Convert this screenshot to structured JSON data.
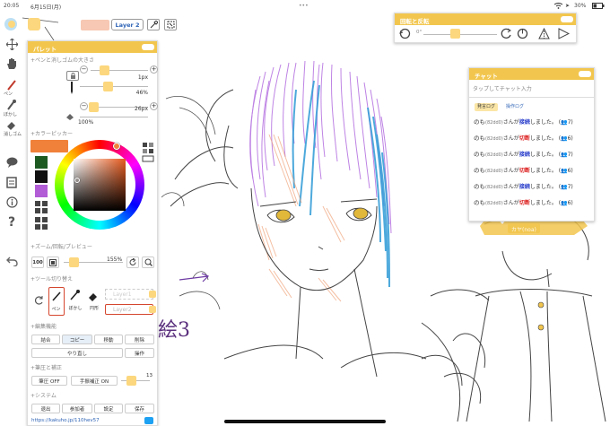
{
  "status": {
    "time": "20:05",
    "date": "6月15日(月)",
    "battery": "30%",
    "menu_dots": "•••"
  },
  "topbar": {
    "layer_label": "Layer 2"
  },
  "tools": [
    {
      "name": "pen",
      "label": "ペン"
    },
    {
      "name": "blur",
      "label": "ぼかし"
    },
    {
      "name": "eraser",
      "label": "消しゴム"
    },
    {
      "name": "fill",
      "label": "円形"
    }
  ],
  "palette": {
    "title": "パレット",
    "pen_section": "+ペンと消しゴムの大きさ",
    "brush_size": "1px",
    "opacity": "46%",
    "eraser_size": "26px",
    "eraser_opacity": "100%",
    "color_section": "+カラーピッカー",
    "colors": {
      "current": "#f0813a",
      "swatch1": "#1d5a22",
      "swatch2": "#111111",
      "swatch3": "#b25cd6"
    },
    "zoom_section": "+ズーム/回転/プレビュー",
    "zoom_value": "100",
    "zoom_percent": "155%",
    "tool_section": "+ツール切り替え",
    "tool_pen": "ペン",
    "tool_blur": "ぼかし",
    "tool_round": "円形",
    "layer1": "Layer1",
    "layer2": "Layer2",
    "edit_section": "+編集機能",
    "edit_merge": "結合",
    "edit_copy": "コピー",
    "edit_move": "移動",
    "edit_delete": "削除",
    "edit_redo": "やり直し",
    "edit_ops": "操作",
    "pressure_section": "+筆圧と補正",
    "pressure_off": "筆圧 OFF",
    "correction_on": "手振補正 ON",
    "correction_value": "13",
    "system_section": "+システム",
    "sys_leave": "退出",
    "sys_participants": "参加者",
    "sys_settings": "設定",
    "sys_save": "保存",
    "url": "https://kakuho.jp/110hev57"
  },
  "rotate_panel": {
    "title": "回転と反転",
    "value": "0°"
  },
  "chat": {
    "title": "チャット",
    "placeholder": "タップしてチャット入力",
    "tab_chat": "発言ログ",
    "tab_ops": "操作ログ",
    "lines": [
      {
        "user": "のも",
        "id": "(82dd0)",
        "mid": "さんが",
        "action": "接続",
        "type": "join",
        "tail": "しました。",
        "count": "7"
      },
      {
        "user": "のも",
        "id": "(82dd0)",
        "mid": "さんが",
        "action": "切断",
        "type": "leave",
        "tail": "しました。",
        "count": "6"
      },
      {
        "user": "のも",
        "id": "(82dd0)",
        "mid": "さんが",
        "action": "接続",
        "type": "join",
        "tail": "しました。",
        "count": "7"
      },
      {
        "user": "のも",
        "id": "(82dd0)",
        "mid": "さんが",
        "action": "切断",
        "type": "leave",
        "tail": "しました。",
        "count": "6"
      },
      {
        "user": "のも",
        "id": "(82dd0)",
        "mid": "さんが",
        "action": "接続",
        "type": "join",
        "tail": "しました。",
        "count": "7"
      },
      {
        "user": "のも",
        "id": "(82dd0)",
        "mid": "さんが",
        "action": "切断",
        "type": "leave",
        "tail": "しました。",
        "count": "6"
      }
    ]
  },
  "canvas": {
    "cursor_label": "カヤ(noa)",
    "handwriting": "絵3"
  }
}
